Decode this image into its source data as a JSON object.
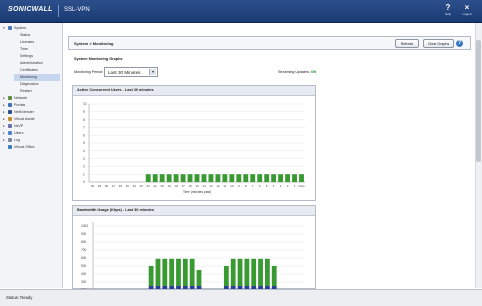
{
  "header": {
    "brand": "SONICWALL",
    "product": "SSL-VPN",
    "help_label": "Help",
    "logout_label": "Logout",
    "help_glyph": "?",
    "logout_glyph": "×"
  },
  "sidebar": {
    "items": [
      {
        "label": "System",
        "icon": "monitor-icon",
        "expanded": true
      },
      {
        "label": "Status"
      },
      {
        "label": "Licenses"
      },
      {
        "label": "Time"
      },
      {
        "label": "Settings"
      },
      {
        "label": "Administration"
      },
      {
        "label": "Certificates"
      },
      {
        "label": "Monitoring",
        "selected": true
      },
      {
        "label": "Diagnostics"
      },
      {
        "label": "Restart"
      },
      {
        "label": "Network",
        "icon": "network-icon"
      },
      {
        "label": "Portals",
        "icon": "portals-icon"
      },
      {
        "label": "NetExtender",
        "icon": "netextender-icon"
      },
      {
        "label": "Virtual Assist",
        "icon": "virtual-assist-icon"
      },
      {
        "label": "NxVP",
        "icon": "nxvp-icon"
      },
      {
        "label": "Users",
        "icon": "users-icon"
      },
      {
        "label": "Log",
        "icon": "log-icon"
      },
      {
        "label": "Virtual Office",
        "icon": "virtual-office-icon"
      }
    ]
  },
  "main": {
    "breadcrumb": "System > Monitoring",
    "refresh_label": "Refresh",
    "clear_label": "Clear Graphs",
    "section_title": "System Monitoring Graphs",
    "period_label": "Monitoring Period:",
    "period_value": "Last 30 Minutes",
    "streaming_label": "Streaming Updates:",
    "streaming_value": "ON"
  },
  "colors": {
    "bar_green": "#3a9a32",
    "bar_blue": "#2b3f9a",
    "header_blue": "#1f3f7a"
  },
  "chart_data": [
    {
      "type": "bar",
      "title": "Active Concurrent Users - Last 30 minutes",
      "xlabel": "Time (minutes past)",
      "ylabel": "",
      "categories": [
        "30",
        "29",
        "28",
        "27",
        "26",
        "25",
        "24",
        "23",
        "22",
        "21",
        "20",
        "19",
        "18",
        "17",
        "16",
        "15",
        "14",
        "13",
        "12",
        "11",
        "10",
        "9",
        "8",
        "7",
        "6",
        "5",
        "4",
        "3",
        "2",
        "1",
        "Now"
      ],
      "values": [
        0,
        0,
        0,
        0,
        0,
        0,
        0,
        0,
        1,
        1,
        1,
        1,
        1,
        1,
        1,
        1,
        1,
        1,
        1,
        1,
        1,
        1,
        1,
        1,
        1,
        1,
        1,
        1,
        1,
        1,
        1
      ],
      "ylim": [
        0,
        10
      ],
      "yticks": [
        "0",
        "1",
        "2",
        "3",
        "4",
        "5",
        "6",
        "7",
        "8",
        "9",
        "10"
      ],
      "grid": true
    },
    {
      "type": "bar",
      "title": "Bandwidth Usage (Kbps) - Last 30 minutes",
      "xlabel": "",
      "ylabel": "",
      "stacked": true,
      "ylim": [
        0,
        1000
      ],
      "yticks": [
        "1000",
        "900",
        "800",
        "700",
        "600",
        "500",
        "400",
        "300",
        "200"
      ],
      "grid": true,
      "series": [
        {
          "values": [
            0,
            0,
            0,
            0,
            0,
            0,
            0,
            0,
            100,
            100,
            100,
            100,
            100,
            100,
            100,
            100,
            0,
            0,
            0,
            100,
            100,
            100,
            100,
            100,
            100,
            100,
            100,
            0,
            0,
            0,
            0
          ]
        },
        {
          "values": [
            0,
            0,
            0,
            0,
            0,
            0,
            0,
            0,
            250,
            340,
            340,
            340,
            340,
            340,
            340,
            200,
            0,
            0,
            0,
            250,
            340,
            340,
            340,
            340,
            340,
            340,
            250,
            0,
            0,
            0,
            0
          ]
        }
      ]
    }
  ]
}
